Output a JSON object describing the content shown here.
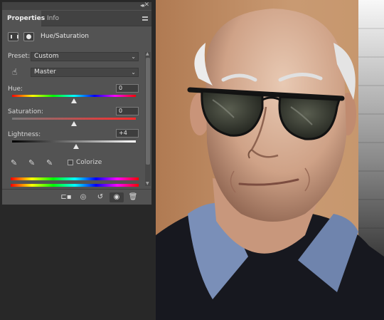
{
  "panel": {
    "tabs": [
      {
        "label": "Properties"
      },
      {
        "label": "Info"
      }
    ],
    "adjustment_title": "Hue/Saturation",
    "preset": {
      "label": "Preset:",
      "value": "Custom"
    },
    "channel": {
      "value": "Master"
    },
    "hue": {
      "label": "Hue:",
      "value": "0",
      "level": 0
    },
    "saturation": {
      "label": "Saturation:",
      "value": "0",
      "level": 0
    },
    "lightness": {
      "label": "Lightness:",
      "value": "+4",
      "level": 4
    },
    "colorize": {
      "label": "Colorize",
      "checked": false
    },
    "footer_icons": [
      "clip-to-layer-icon",
      "view-previous-state-icon",
      "reset-icon",
      "visibility-eye-icon",
      "trash-icon"
    ]
  },
  "colors": {
    "panel_bg": "#535353",
    "tab_strip": "#424242",
    "workspace_bg": "#282828",
    "saturation_end": "#ff2a2a"
  }
}
